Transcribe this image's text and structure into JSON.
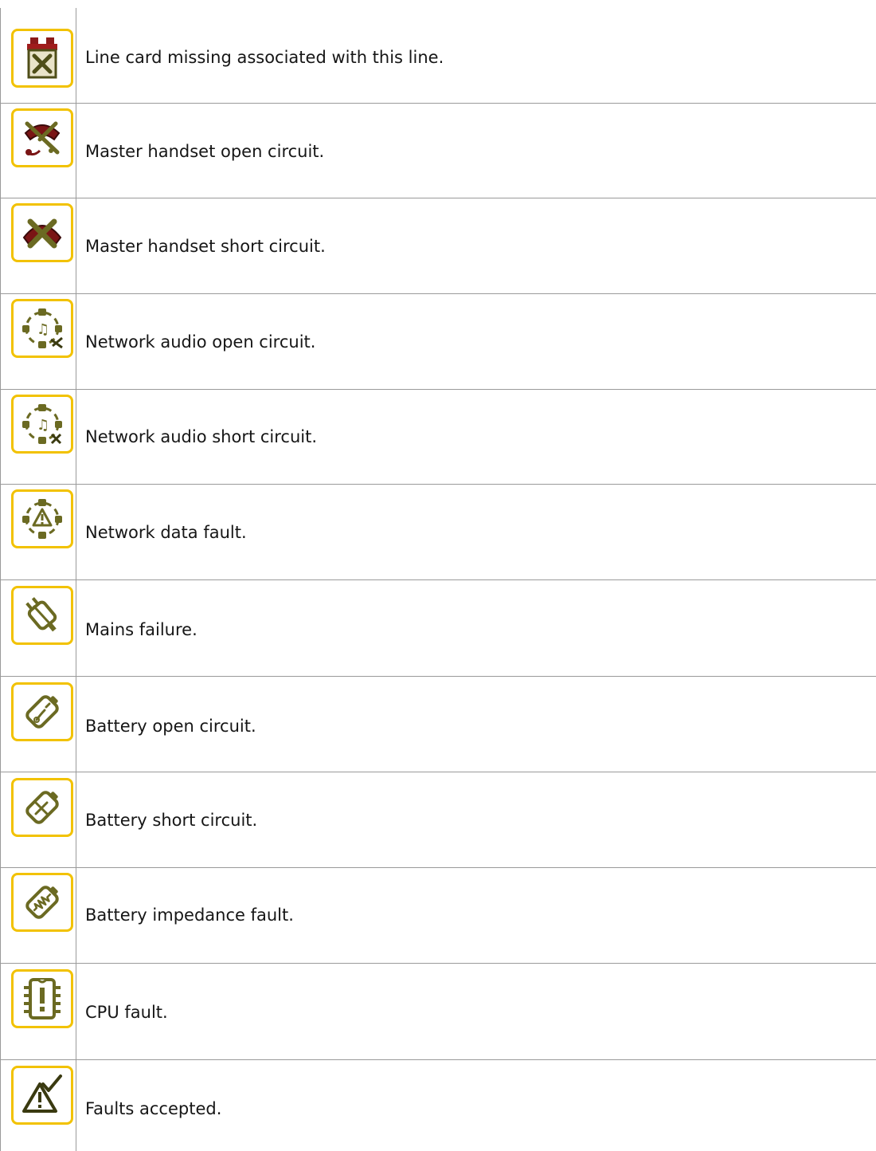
{
  "faults": [
    {
      "icon": "line-card-missing-icon",
      "text": "Line card missing associated with this line."
    },
    {
      "icon": "master-handset-open-circuit-icon",
      "text": "Master handset open circuit."
    },
    {
      "icon": "master-handset-short-circuit-icon",
      "text": "Master handset short circuit."
    },
    {
      "icon": "network-audio-open-circuit-icon",
      "text": "Network audio open circuit."
    },
    {
      "icon": "network-audio-short-circuit-icon",
      "text": "Network audio short circuit."
    },
    {
      "icon": "network-data-fault-icon",
      "text": "Network data fault."
    },
    {
      "icon": "mains-failure-icon",
      "text": "Mains failure."
    },
    {
      "icon": "battery-open-circuit-icon",
      "text": "Battery open circuit."
    },
    {
      "icon": "battery-short-circuit-icon",
      "text": "Battery short circuit."
    },
    {
      "icon": "battery-impedance-fault-icon",
      "text": "Battery impedance fault."
    },
    {
      "icon": "cpu-fault-icon",
      "text": "CPU fault."
    },
    {
      "icon": "faults-accepted-icon",
      "text": "Faults accepted."
    }
  ],
  "colors": {
    "icon_border": "#f2c200",
    "icon_olive": "#6b6a22",
    "icon_dark_red": "#7a1515",
    "rule": "#9a9a9a"
  }
}
